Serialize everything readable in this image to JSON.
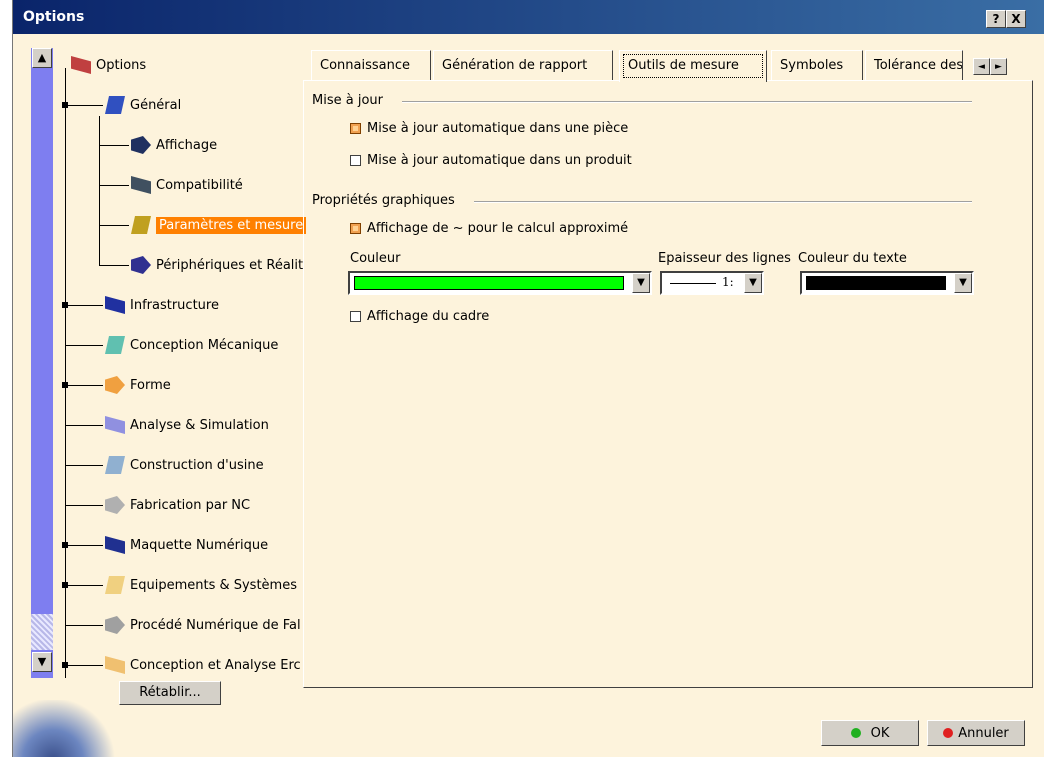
{
  "window": {
    "title": "Options",
    "help": "?",
    "close": "X"
  },
  "tree": {
    "items": [
      {
        "label": "Options",
        "icon": "options-icon"
      },
      {
        "label": "Général",
        "icon": "general-icon"
      },
      {
        "label": "Affichage",
        "icon": "display-icon"
      },
      {
        "label": "Compatibilité",
        "icon": "compatibility-icon"
      },
      {
        "label": "Paramètres et mesure",
        "icon": "parameters-icon",
        "selected": true
      },
      {
        "label": "Périphériques et Réalit",
        "icon": "devices-icon"
      },
      {
        "label": "Infrastructure",
        "icon": "infrastructure-icon"
      },
      {
        "label": "Conception Mécanique",
        "icon": "mechanical-design-icon"
      },
      {
        "label": "Forme",
        "icon": "shape-icon"
      },
      {
        "label": "Analyse & Simulation",
        "icon": "analysis-icon"
      },
      {
        "label": "Construction d'usine",
        "icon": "plant-icon"
      },
      {
        "label": "Fabrication par NC",
        "icon": "nc-icon"
      },
      {
        "label": "Maquette Numérique",
        "icon": "digital-mockup-icon"
      },
      {
        "label": "Equipements & Systèmes",
        "icon": "equipment-icon"
      },
      {
        "label": "Procédé Numérique de Fal",
        "icon": "process-icon"
      },
      {
        "label": "Conception et Analyse Erc",
        "icon": "ergonomics-icon"
      }
    ],
    "reset_label": "Rétablir..."
  },
  "tabs": [
    {
      "label": "Connaissance"
    },
    {
      "label": "Génération de rapport"
    },
    {
      "label": "Outils de mesure",
      "active": true
    },
    {
      "label": "Symboles"
    },
    {
      "label": "Tolérance des"
    }
  ],
  "tab_nav": {
    "prev": "◄",
    "next": "►"
  },
  "update": {
    "group_title": "Mise à jour",
    "auto_part": {
      "label": "Mise à jour automatique dans une pièce",
      "checked": true
    },
    "auto_product": {
      "label": "Mise à jour automatique dans un produit",
      "checked": false
    }
  },
  "graphics": {
    "group_title": "Propriétés graphiques",
    "approx_display": {
      "label": "Affichage de ~ pour le calcul approximé",
      "checked": true
    },
    "color_label": "Couleur",
    "color_value": "#00ff00",
    "line_thickness_label": "Epaisseur des lignes",
    "line_thickness_value": "1:",
    "text_color_label": "Couleur du texte",
    "text_color_value": "#000000",
    "frame_display": {
      "label": "Affichage du cadre",
      "checked": false
    }
  },
  "buttons": {
    "ok": "OK",
    "cancel": "Annuler",
    "ok_color": "#20b020",
    "cancel_color": "#e02020"
  }
}
